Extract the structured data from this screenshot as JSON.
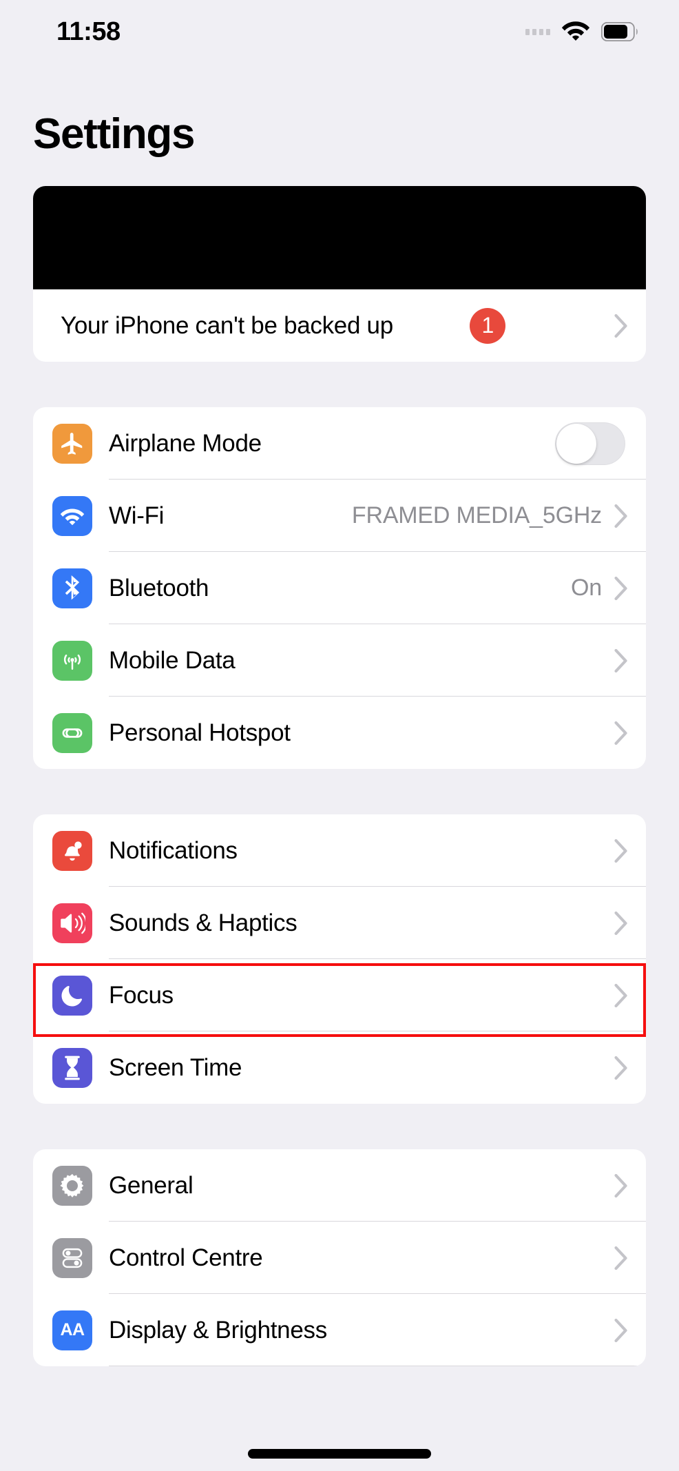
{
  "status_bar": {
    "time": "11:58",
    "signal_icon": "signal-dots-icon",
    "wifi_icon": "wifi-icon",
    "battery_icon": "battery-icon"
  },
  "header": {
    "title": "Settings"
  },
  "colors": {
    "background": "#f0eff4",
    "card": "#ffffff",
    "separator": "#d8d7dc",
    "value_text": "#8e8e93",
    "badge_red": "#e8493c",
    "highlight_red": "#f50e0e",
    "orange": "#f0993c",
    "blue": "#3478f6",
    "green": "#5bc466",
    "red": "#ea4a3c",
    "pink": "#f0405c",
    "indigo": "#5a56d6",
    "gray": "#9b9ba0"
  },
  "groups": [
    {
      "name": "account-group",
      "redacted_banner": true,
      "rows": [
        {
          "label": "Your iPhone can't be backed up",
          "icon": null,
          "value": null,
          "badge": "1",
          "accessory": "chevron",
          "no_icon": true
        }
      ]
    },
    {
      "name": "connectivity-group",
      "redacted_banner": false,
      "rows": [
        {
          "label": "Airplane Mode",
          "icon": "airplane-icon",
          "icon_color": "#f0993c",
          "value": null,
          "accessory": "toggle",
          "toggle_on": false
        },
        {
          "label": "Wi-Fi",
          "icon": "wifi-tile-icon",
          "icon_color": "#3478f6",
          "value": "FRAMED MEDIA_5GHz",
          "accessory": "chevron"
        },
        {
          "label": "Bluetooth",
          "icon": "bluetooth-icon",
          "icon_color": "#3478f6",
          "value": "On",
          "accessory": "chevron"
        },
        {
          "label": "Mobile Data",
          "icon": "cell-tower-icon",
          "icon_color": "#5bc466",
          "value": null,
          "accessory": "chevron"
        },
        {
          "label": "Personal Hotspot",
          "icon": "hotspot-link-icon",
          "icon_color": "#5bc466",
          "value": null,
          "accessory": "chevron"
        }
      ]
    },
    {
      "name": "notifications-group",
      "redacted_banner": false,
      "rows": [
        {
          "label": "Notifications",
          "icon": "bell-icon",
          "icon_color": "#ea4a3c",
          "value": null,
          "accessory": "chevron"
        },
        {
          "label": "Sounds & Haptics",
          "icon": "speaker-waves-icon",
          "icon_color": "#f0405c",
          "value": null,
          "accessory": "chevron",
          "highlighted": true
        },
        {
          "label": "Focus",
          "icon": "moon-icon",
          "icon_color": "#5a56d6",
          "value": null,
          "accessory": "chevron"
        },
        {
          "label": "Screen Time",
          "icon": "hourglass-icon",
          "icon_color": "#5a56d6",
          "value": null,
          "accessory": "chevron"
        }
      ]
    },
    {
      "name": "system-group",
      "redacted_banner": false,
      "rows": [
        {
          "label": "General",
          "icon": "gear-icon",
          "icon_color": "#9b9ba0",
          "value": null,
          "accessory": "chevron"
        },
        {
          "label": "Control Centre",
          "icon": "sliders-toggles-icon",
          "icon_color": "#9b9ba0",
          "value": null,
          "accessory": "chevron"
        },
        {
          "label": "Display & Brightness",
          "icon": "text-size-aa-icon",
          "icon_color": "#3478f6",
          "value": null,
          "accessory": "chevron"
        }
      ]
    }
  ],
  "home_indicator": "home-indicator"
}
